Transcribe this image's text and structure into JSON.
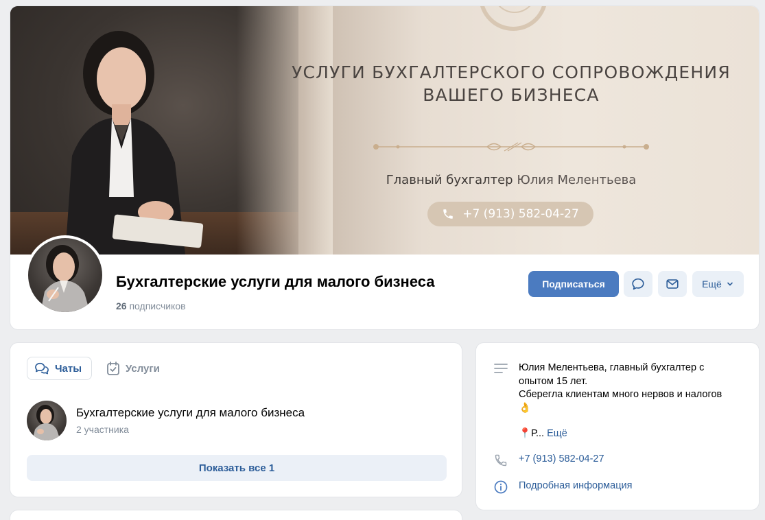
{
  "cover": {
    "title_line1": "УСЛУГИ БУХГАЛТЕРСКОГО СОПРОВОЖДЕНИЯ",
    "title_line2": "ВАШЕГО БИЗНЕСА",
    "subtitle_role": "Главный бухгалтер",
    "subtitle_name": "Юлия Мелентьева",
    "phone": "+7 (913) 582-04-27"
  },
  "group": {
    "name": "Бухгалтерские услуги для малого бизнеса",
    "subscribers_count": "26",
    "subscribers_label": "подписчиков"
  },
  "actions": {
    "subscribe_label": "Подписаться",
    "chat_icon": "chat-bubble-icon",
    "message_icon": "envelope-icon",
    "more_label": "Ещё"
  },
  "tabs": [
    {
      "label": "Чаты",
      "icon": "chats-icon",
      "active": true
    },
    {
      "label": "Услуги",
      "icon": "services-icon",
      "active": false
    }
  ],
  "chat": {
    "name": "Бухгалтерские услуги для малого бизнеса",
    "members": "2 участника",
    "show_all": "Показать все 1"
  },
  "info": {
    "description_lines": [
      "Юлия Мелентьева, главный бухгалтер с",
      "опытом 15 лет.",
      "Сберегла клиентам много нервов и налогов",
      "👌"
    ],
    "truncated_text": "📍Р...",
    "more_label": "Ещё",
    "phone": "+7 (913) 582-04-27",
    "details_label": "Подробная информация"
  },
  "colors": {
    "accent": "#4b7bc0",
    "link": "#2c5d99",
    "secondary_text": "#818c99",
    "background": "#edeef0"
  }
}
